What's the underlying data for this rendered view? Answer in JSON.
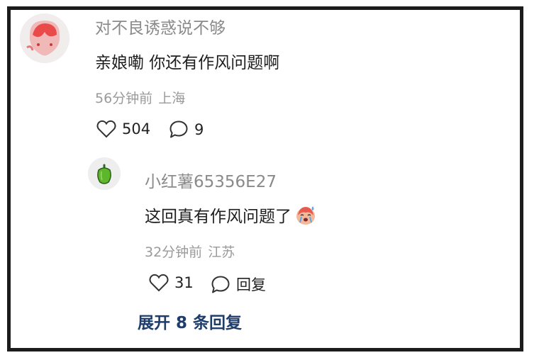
{
  "comment": {
    "username": "对不良诱惑说不够",
    "text": "亲娘嘞 你还有作风问题啊",
    "time": "56分钟前",
    "location": "上海",
    "likes": "504",
    "replies": "9"
  },
  "reply": {
    "username": "小红薯65356E27",
    "text": "这回真有作风问题了",
    "emoji": "crying-face",
    "time": "32分钟前",
    "location": "江苏",
    "likes": "31",
    "reply_label": "回复"
  },
  "expand_label": "展开 8 条回复"
}
